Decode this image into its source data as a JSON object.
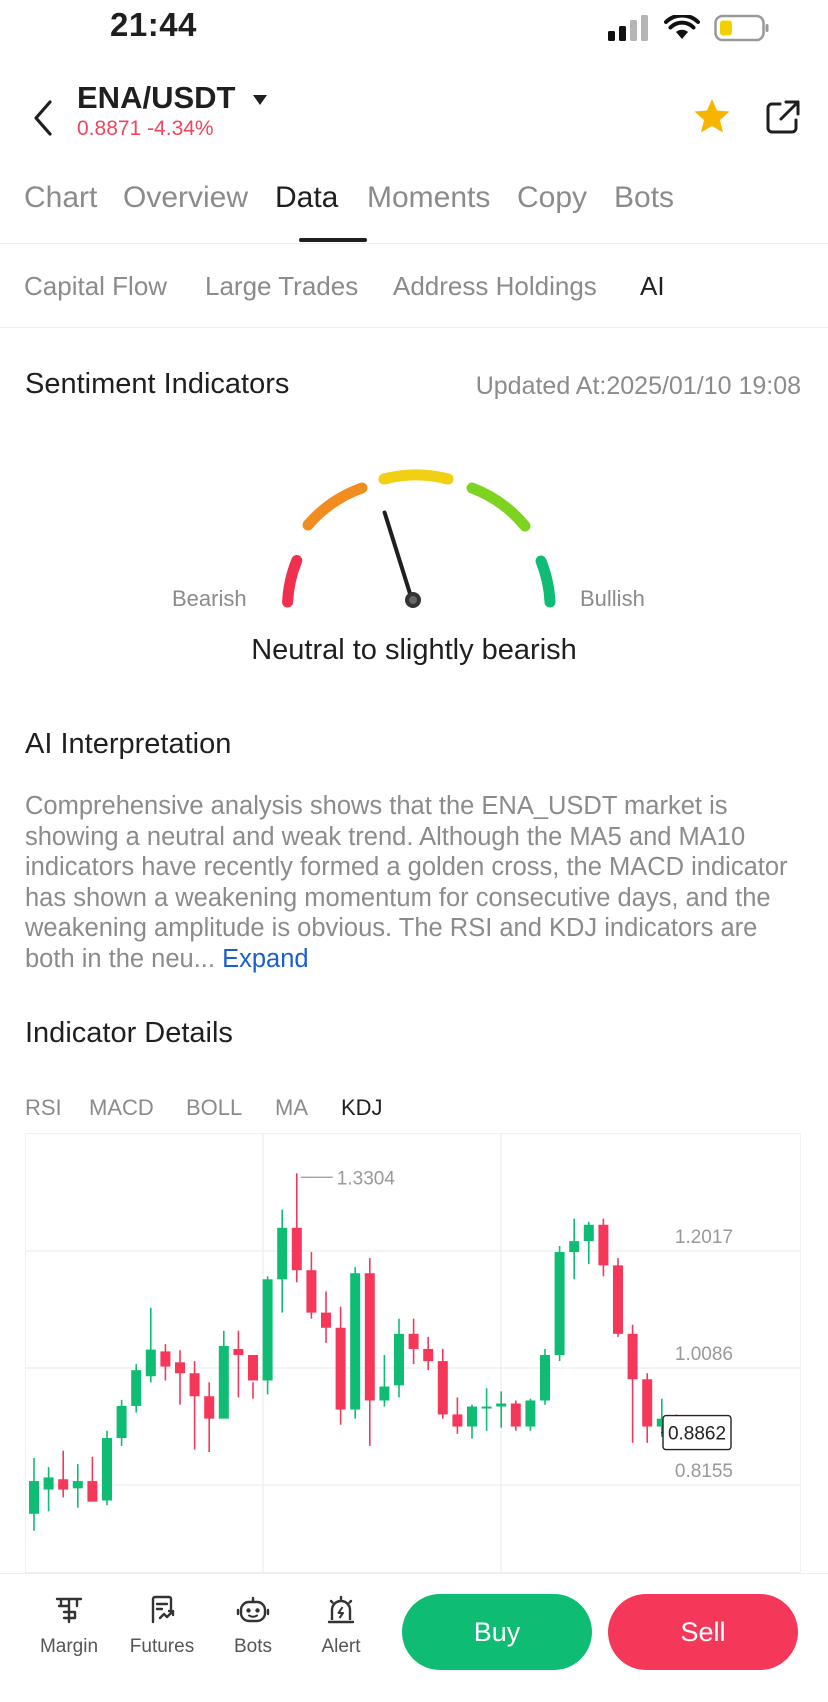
{
  "status_bar": {
    "time": "21:44"
  },
  "header": {
    "pair": "ENA/USDT",
    "price_change": "0.8871 -4.34%"
  },
  "tabs": [
    {
      "label": "Chart",
      "active": false
    },
    {
      "label": "Overview",
      "active": false
    },
    {
      "label": "Data",
      "active": true
    },
    {
      "label": "Moments",
      "active": false
    },
    {
      "label": "Copy",
      "active": false
    },
    {
      "label": "Bots",
      "active": false
    }
  ],
  "subtabs": [
    {
      "label": "Capital Flow",
      "active": false
    },
    {
      "label": "Large Trades",
      "active": false
    },
    {
      "label": "Address Holdings",
      "active": false
    },
    {
      "label": "AI",
      "active": true
    }
  ],
  "sentiment": {
    "title": "Sentiment Indicators",
    "updated": "Updated At:2025/01/10 19:08",
    "left_label": "Bearish",
    "right_label": "Bullish",
    "result": "Neutral to slightly bearish",
    "level": 0.4
  },
  "ai_interpretation": {
    "title": "AI Interpretation",
    "text": "Comprehensive analysis shows that the ENA_USDT market is showing a neutral and weak trend. Although the MA5 and MA10 indicators have recently formed a golden cross, the MACD indicator has shown a weakening momentum for consecutive days, and the weakening amplitude is obvious. The RSI and KDJ indicators are both in the neu...",
    "expand": "Expand"
  },
  "indicator_details": {
    "title": "Indicator Details",
    "tabs": [
      {
        "label": "RSI",
        "active": false
      },
      {
        "label": "MACD",
        "active": false
      },
      {
        "label": "BOLL",
        "active": false
      },
      {
        "label": "MA",
        "active": false
      },
      {
        "label": "KDJ",
        "active": true
      }
    ]
  },
  "chart_data": {
    "type": "candlestick",
    "y_ticks": [
      "1.2017",
      "1.0086",
      "0.8155"
    ],
    "y_ticks_values": [
      1.2017,
      1.0086,
      0.8155
    ],
    "high_label": "1.3304",
    "current_price": "0.8862",
    "candles": [
      {
        "o": 0.768,
        "h": 0.86,
        "l": 0.74,
        "c": 0.822
      },
      {
        "o": 0.808,
        "h": 0.845,
        "l": 0.772,
        "c": 0.828
      },
      {
        "o": 0.825,
        "h": 0.872,
        "l": 0.795,
        "c": 0.808
      },
      {
        "o": 0.81,
        "h": 0.85,
        "l": 0.778,
        "c": 0.822
      },
      {
        "o": 0.822,
        "h": 0.862,
        "l": 0.795,
        "c": 0.788
      },
      {
        "o": 0.79,
        "h": 0.905,
        "l": 0.782,
        "c": 0.893
      },
      {
        "o": 0.893,
        "h": 0.956,
        "l": 0.88,
        "c": 0.946
      },
      {
        "o": 0.946,
        "h": 1.015,
        "l": 0.935,
        "c": 1.005
      },
      {
        "o": 0.995,
        "h": 1.108,
        "l": 0.985,
        "c": 1.039
      },
      {
        "o": 1.036,
        "h": 1.048,
        "l": 0.988,
        "c": 1.011
      },
      {
        "o": 1.018,
        "h": 1.038,
        "l": 0.948,
        "c": 1.0
      },
      {
        "o": 1.0,
        "h": 1.02,
        "l": 0.874,
        "c": 0.962
      },
      {
        "o": 0.962,
        "h": 0.985,
        "l": 0.87,
        "c": 0.925
      },
      {
        "o": 0.925,
        "h": 1.07,
        "l": 0.925,
        "c": 1.045
      },
      {
        "o": 1.04,
        "h": 1.07,
        "l": 0.96,
        "c": 1.03
      },
      {
        "o": 1.03,
        "h": 0.985,
        "l": 0.958,
        "c": 0.988
      },
      {
        "o": 0.988,
        "h": 1.16,
        "l": 0.965,
        "c": 1.155
      },
      {
        "o": 1.155,
        "h": 1.27,
        "l": 1.1,
        "c": 1.24
      },
      {
        "o": 1.24,
        "h": 1.33,
        "l": 1.15,
        "c": 1.17
      },
      {
        "o": 1.17,
        "h": 1.2,
        "l": 1.09,
        "c": 1.1
      },
      {
        "o": 1.1,
        "h": 1.135,
        "l": 1.05,
        "c": 1.075
      },
      {
        "o": 1.075,
        "h": 1.11,
        "l": 0.915,
        "c": 0.94
      },
      {
        "o": 0.94,
        "h": 1.175,
        "l": 0.925,
        "c": 1.165
      },
      {
        "o": 1.165,
        "h": 1.19,
        "l": 0.88,
        "c": 0.955
      },
      {
        "o": 0.955,
        "h": 1.03,
        "l": 0.945,
        "c": 0.978
      },
      {
        "o": 0.98,
        "h": 1.09,
        "l": 0.96,
        "c": 1.065
      },
      {
        "o": 1.065,
        "h": 1.09,
        "l": 1.015,
        "c": 1.04
      },
      {
        "o": 1.04,
        "h": 1.06,
        "l": 1.005,
        "c": 1.02
      },
      {
        "o": 1.02,
        "h": 1.04,
        "l": 0.925,
        "c": 0.932
      },
      {
        "o": 0.932,
        "h": 0.96,
        "l": 0.9,
        "c": 0.912
      },
      {
        "o": 0.912,
        "h": 0.948,
        "l": 0.892,
        "c": 0.945
      },
      {
        "o": 0.945,
        "h": 0.975,
        "l": 0.905,
        "c": 0.945
      },
      {
        "o": 0.945,
        "h": 0.97,
        "l": 0.91,
        "c": 0.95
      },
      {
        "o": 0.95,
        "h": 0.955,
        "l": 0.905,
        "c": 0.912
      },
      {
        "o": 0.912,
        "h": 0.958,
        "l": 0.905,
        "c": 0.955
      },
      {
        "o": 0.955,
        "h": 1.04,
        "l": 0.948,
        "c": 1.03
      },
      {
        "o": 1.03,
        "h": 1.21,
        "l": 1.02,
        "c": 1.2
      },
      {
        "o": 1.2,
        "h": 1.255,
        "l": 1.155,
        "c": 1.218
      },
      {
        "o": 1.218,
        "h": 1.25,
        "l": 1.18,
        "c": 1.245
      },
      {
        "o": 1.245,
        "h": 1.255,
        "l": 1.16,
        "c": 1.178
      },
      {
        "o": 1.178,
        "h": 1.19,
        "l": 1.06,
        "c": 1.065
      },
      {
        "o": 1.065,
        "h": 1.08,
        "l": 0.885,
        "c": 0.99
      },
      {
        "o": 0.99,
        "h": 1.0,
        "l": 0.885,
        "c": 0.912
      },
      {
        "o": 0.912,
        "h": 0.958,
        "l": 0.895,
        "c": 0.925
      },
      {
        "o": 0.925,
        "h": 0.932,
        "l": 0.895,
        "c": 0.902
      }
    ],
    "colors": {
      "up": "#0fbc73",
      "down": "#f5385a"
    }
  },
  "bottom_nav": [
    {
      "label": "Margin",
      "icon": "margin-icon"
    },
    {
      "label": "Futures",
      "icon": "futures-icon"
    },
    {
      "label": "Bots",
      "icon": "bots-icon"
    },
    {
      "label": "Alert",
      "icon": "alert-icon"
    }
  ],
  "actions": {
    "buy": "Buy",
    "sell": "Sell"
  },
  "colors": {
    "up": "#0fbc73",
    "down": "#f5385a",
    "link": "#1a5fcc",
    "star": "#f7b500"
  }
}
